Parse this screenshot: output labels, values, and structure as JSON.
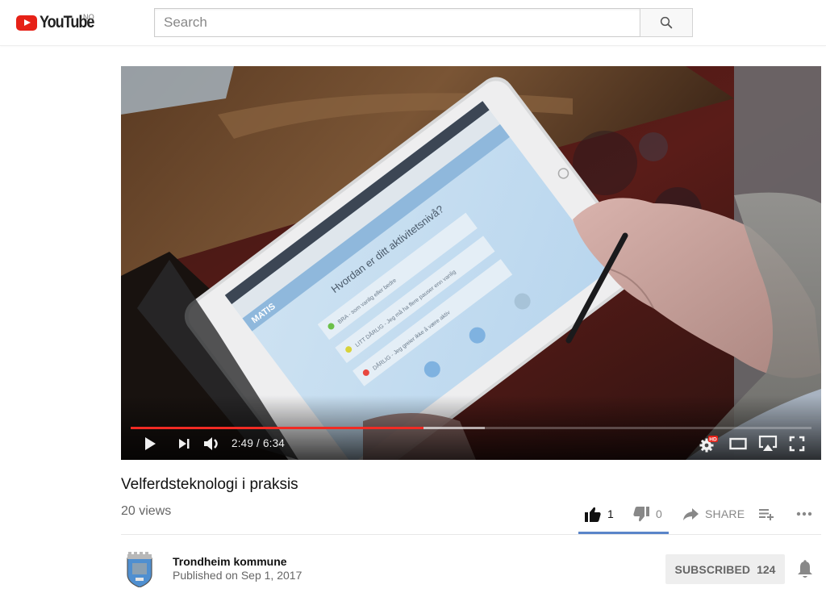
{
  "masthead": {
    "logo_text": "YouTube",
    "region": "NO",
    "search": {
      "placeholder": "Search",
      "value": ""
    },
    "icons": {
      "logo": "youtube-logo-icon",
      "search": "search-icon"
    }
  },
  "player": {
    "current_time": "2:49",
    "separator": " / ",
    "duration": "6:34",
    "played_fraction": 0.43,
    "buffered_fraction": 0.52,
    "hd_badge": "HD",
    "scene": {
      "description": "Elderly hand with stylus using a tablet",
      "tablet_question": "Hvordan er ditt aktivitetsnivå?",
      "tablet_app": "MATIS",
      "tablet_options": [
        {
          "label": "BRA - som vanlig eller bedre",
          "color": "#6cc04a"
        },
        {
          "label": "LITT DÅRLIG - Jeg må ha flere pauser enn vanlig",
          "color": "#d8d23a"
        },
        {
          "label": "DÅRLIG - Jeg greier ikke å være aktiv",
          "color": "#e8473f"
        }
      ]
    },
    "controls": [
      "play",
      "next",
      "volume",
      "settings",
      "theater",
      "airplay",
      "fullscreen"
    ]
  },
  "video": {
    "title": "Velferdsteknologi i praksis",
    "views": "20 views",
    "likes": "1",
    "dislikes": "0",
    "like_ratio": 1.0,
    "share_label": "SHARE",
    "icons": {
      "like": "thumbs-up-icon",
      "dislike": "thumbs-down-icon",
      "share": "share-arrow-icon",
      "add": "add-to-playlist-icon",
      "more": "more-actions-icon"
    }
  },
  "owner": {
    "channel_name": "Trondheim kommune",
    "published": "Published on Sep 1, 2017",
    "subscribe_label": "SUBSCRIBED",
    "subscriber_count": "124"
  },
  "colors": {
    "youtube_red": "#e62117",
    "progress_red": "#f12b24",
    "sentiment_blue": "#5a85c9",
    "subscribed_bg": "#eeeeee"
  }
}
